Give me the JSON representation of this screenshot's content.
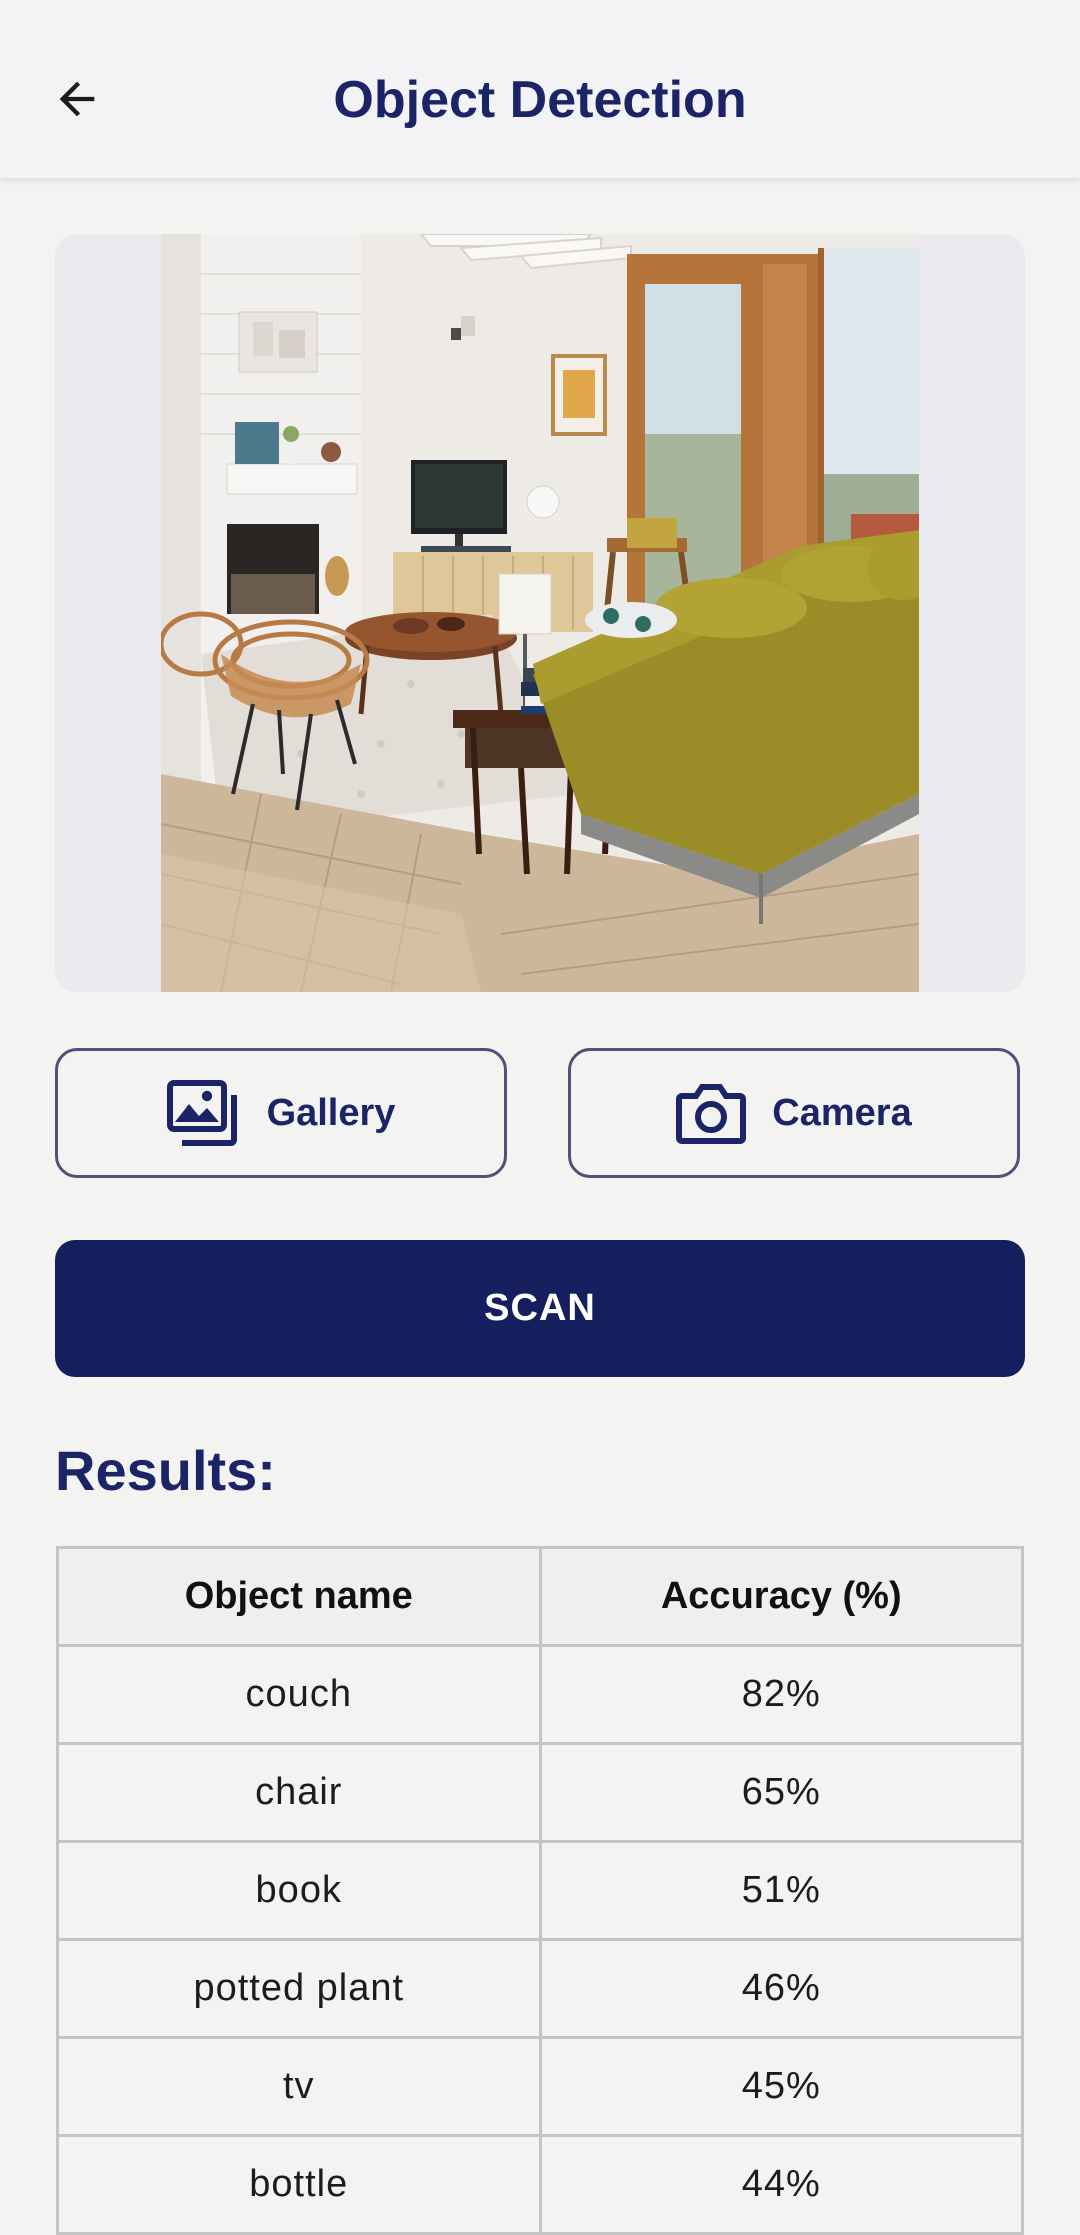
{
  "app_bar": {
    "title": "Object Detection",
    "back_icon": "arrow-left-icon"
  },
  "image_picker": {
    "gallery_label": "Gallery",
    "gallery_icon": "image-gallery-icon",
    "camera_label": "Camera",
    "camera_icon": "camera-icon"
  },
  "scan_label": "SCAN",
  "results": {
    "heading": "Results:",
    "columns": [
      "Object name",
      "Accuracy (%)"
    ],
    "rows": [
      {
        "name": "couch",
        "accuracy": "82%"
      },
      {
        "name": "chair",
        "accuracy": "65%"
      },
      {
        "name": "book",
        "accuracy": "51%"
      },
      {
        "name": "potted plant",
        "accuracy": "46%"
      },
      {
        "name": "tv",
        "accuracy": "45%"
      },
      {
        "name": "bottle",
        "accuracy": "44%"
      }
    ]
  },
  "colors": {
    "primary": "#151f5e",
    "title_text": "#1a2466",
    "outline": "#4c527a",
    "background": "#f3f4f2",
    "couch": "#9a8c26"
  }
}
